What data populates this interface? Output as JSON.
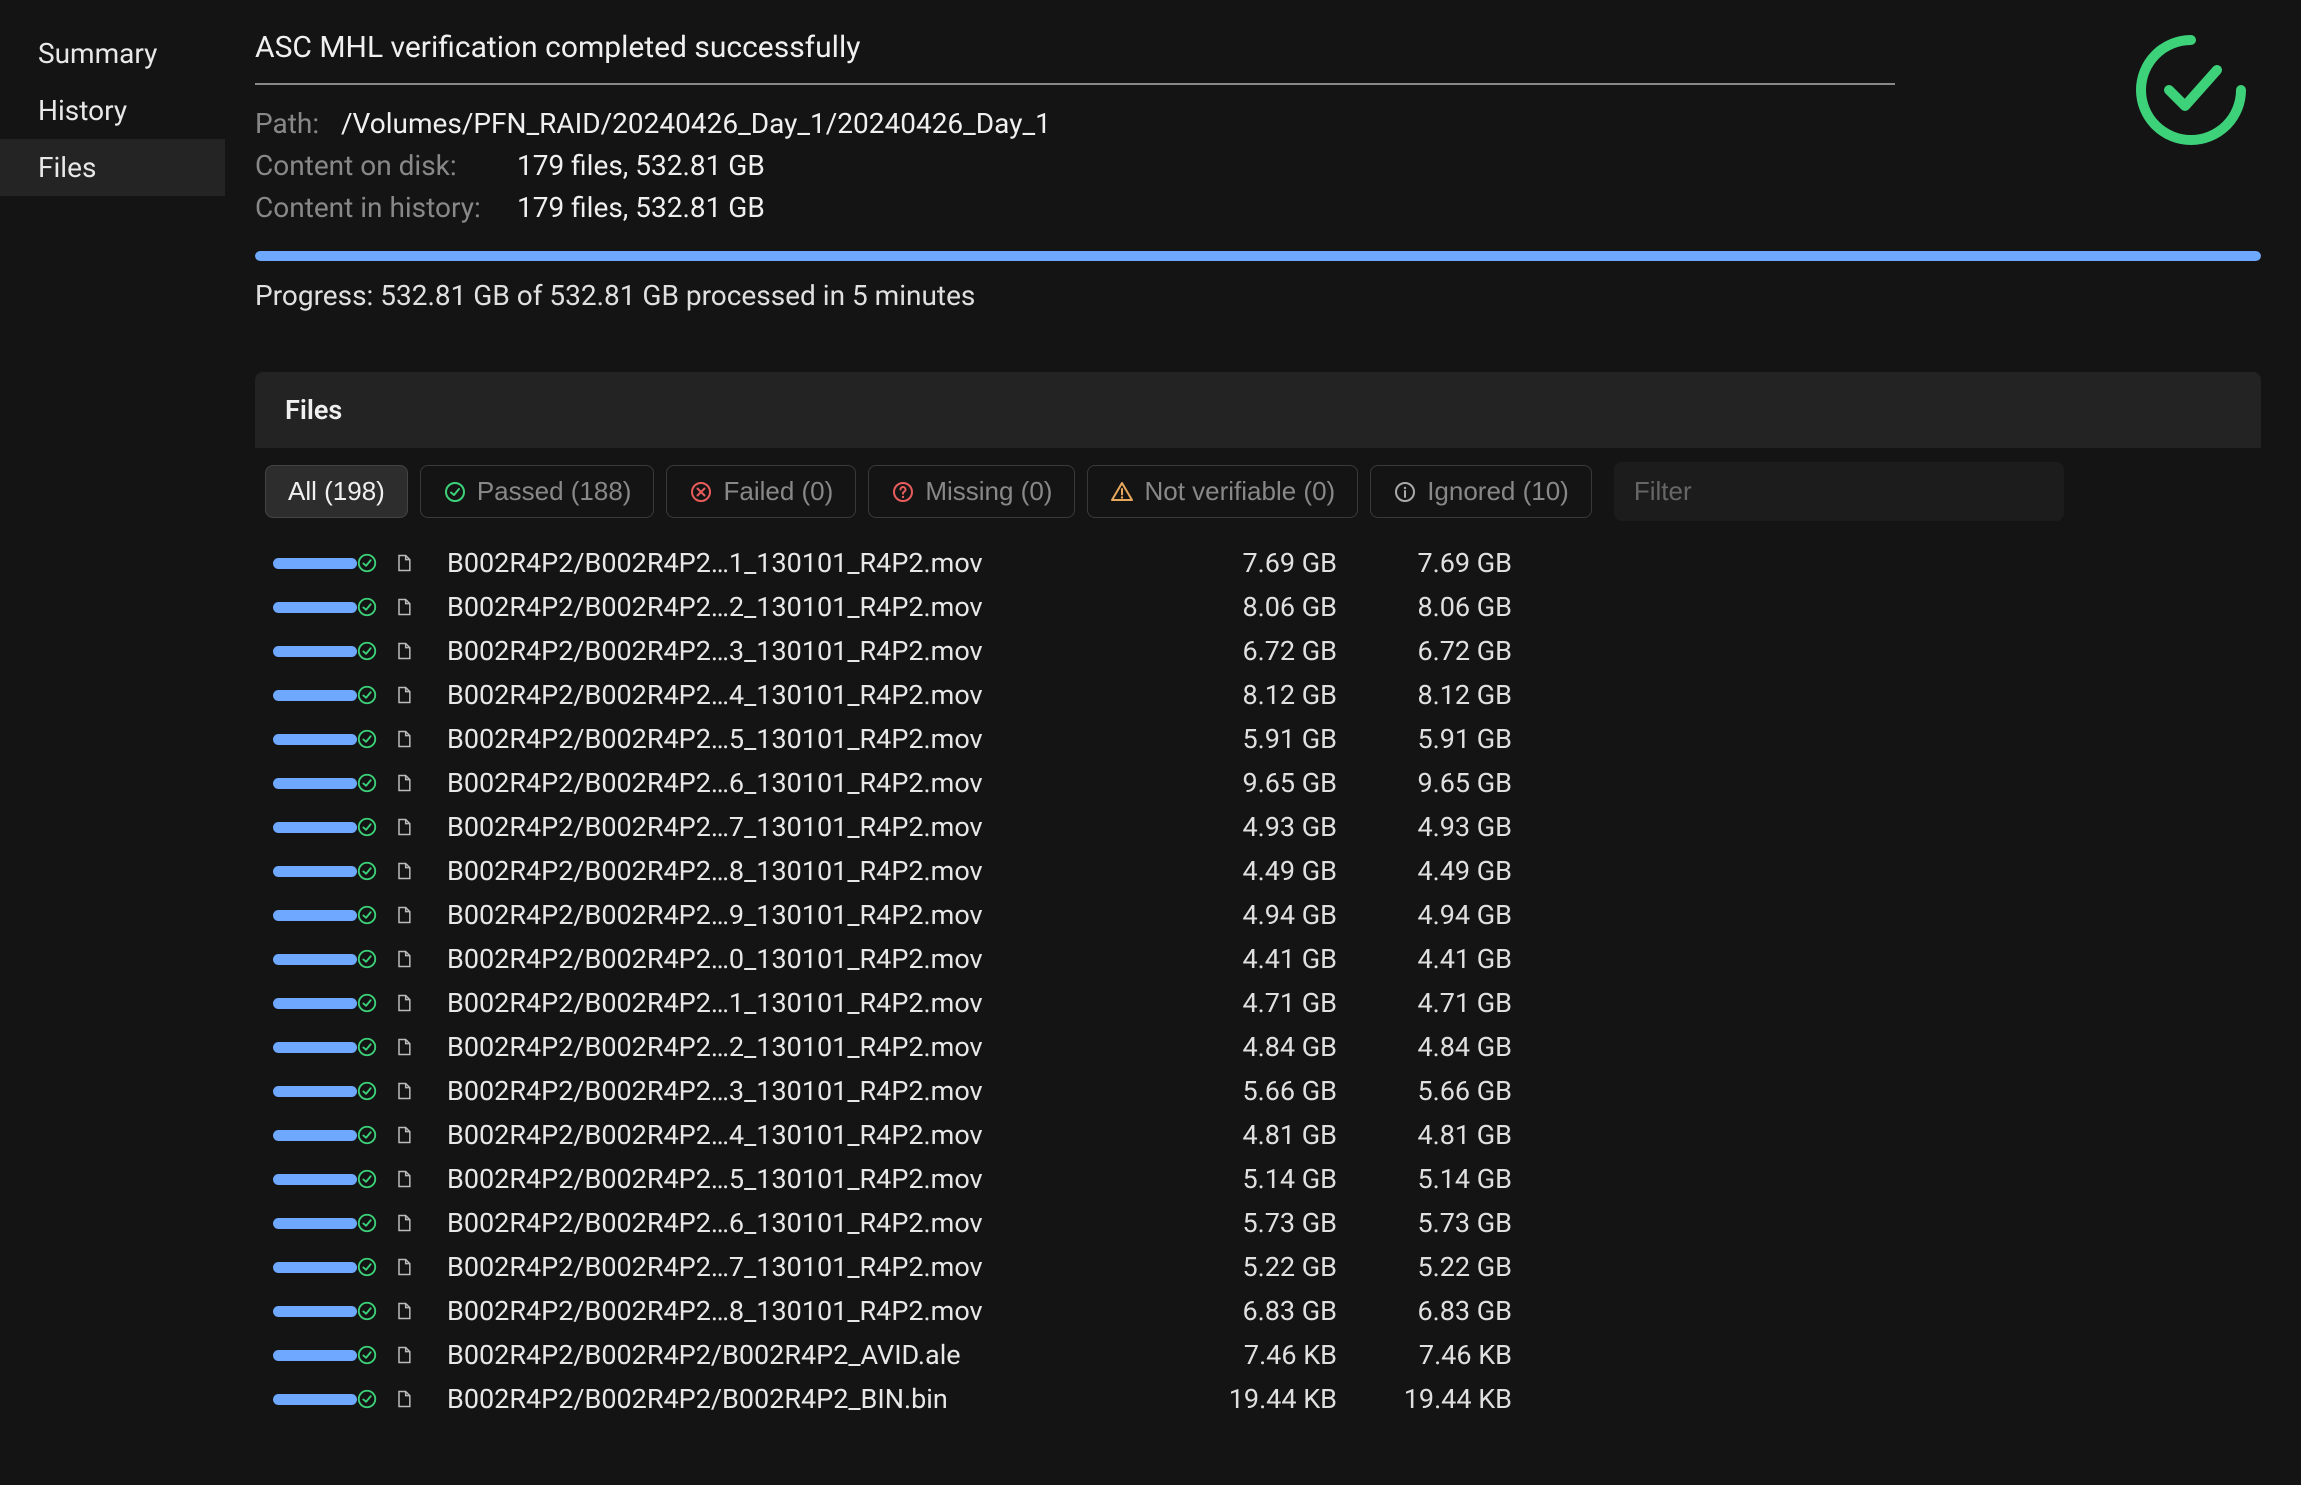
{
  "sidebar": {
    "items": [
      {
        "label": "Summary",
        "active": false
      },
      {
        "label": "History",
        "active": false
      },
      {
        "label": "Files",
        "active": true
      }
    ]
  },
  "header": {
    "title": "ASC MHL verification completed successfully",
    "path_label": "Path:",
    "path_value": "/Volumes/PFN_RAID/20240426_Day_1/20240426_Day_1",
    "disk_label": "Content on disk:",
    "disk_value": "179 files, 532.81 GB",
    "history_label": "Content in history:",
    "history_value": "179 files, 532.81 GB",
    "progress_pct": 100,
    "progress_text": "Progress: 532.81 GB of 532.81 GB processed in 5 minutes"
  },
  "colors": {
    "accent_blue": "#6ea8ff",
    "accent_green": "#3dd17a",
    "accent_red": "#e85c5c",
    "accent_orange": "#e8a85c"
  },
  "section": {
    "title": "Files",
    "filters": {
      "all": "All (198)",
      "passed": "Passed (188)",
      "failed": "Failed (0)",
      "missing": "Missing (0)",
      "not_verifiable": "Not verifiable (0)",
      "ignored": "Ignored (10)",
      "filter_placeholder": "Filter"
    }
  },
  "files": [
    {
      "name": "B002R4P2/B002R4P2…1_130101_R4P2.mov",
      "s1": "7.69 GB",
      "s2": "7.69 GB"
    },
    {
      "name": "B002R4P2/B002R4P2…2_130101_R4P2.mov",
      "s1": "8.06 GB",
      "s2": "8.06 GB"
    },
    {
      "name": "B002R4P2/B002R4P2…3_130101_R4P2.mov",
      "s1": "6.72 GB",
      "s2": "6.72 GB"
    },
    {
      "name": "B002R4P2/B002R4P2…4_130101_R4P2.mov",
      "s1": "8.12 GB",
      "s2": "8.12 GB"
    },
    {
      "name": "B002R4P2/B002R4P2…5_130101_R4P2.mov",
      "s1": "5.91 GB",
      "s2": "5.91 GB"
    },
    {
      "name": "B002R4P2/B002R4P2…6_130101_R4P2.mov",
      "s1": "9.65 GB",
      "s2": "9.65 GB"
    },
    {
      "name": "B002R4P2/B002R4P2…7_130101_R4P2.mov",
      "s1": "4.93 GB",
      "s2": "4.93 GB"
    },
    {
      "name": "B002R4P2/B002R4P2…8_130101_R4P2.mov",
      "s1": "4.49 GB",
      "s2": "4.49 GB"
    },
    {
      "name": "B002R4P2/B002R4P2…9_130101_R4P2.mov",
      "s1": "4.94 GB",
      "s2": "4.94 GB"
    },
    {
      "name": "B002R4P2/B002R4P2…0_130101_R4P2.mov",
      "s1": "4.41 GB",
      "s2": "4.41 GB"
    },
    {
      "name": "B002R4P2/B002R4P2…1_130101_R4P2.mov",
      "s1": "4.71 GB",
      "s2": "4.71 GB"
    },
    {
      "name": "B002R4P2/B002R4P2…2_130101_R4P2.mov",
      "s1": "4.84 GB",
      "s2": "4.84 GB"
    },
    {
      "name": "B002R4P2/B002R4P2…3_130101_R4P2.mov",
      "s1": "5.66 GB",
      "s2": "5.66 GB"
    },
    {
      "name": "B002R4P2/B002R4P2…4_130101_R4P2.mov",
      "s1": "4.81 GB",
      "s2": "4.81 GB"
    },
    {
      "name": "B002R4P2/B002R4P2…5_130101_R4P2.mov",
      "s1": "5.14 GB",
      "s2": "5.14 GB"
    },
    {
      "name": "B002R4P2/B002R4P2…6_130101_R4P2.mov",
      "s1": "5.73 GB",
      "s2": "5.73 GB"
    },
    {
      "name": "B002R4P2/B002R4P2…7_130101_R4P2.mov",
      "s1": "5.22 GB",
      "s2": "5.22 GB"
    },
    {
      "name": "B002R4P2/B002R4P2…8_130101_R4P2.mov",
      "s1": "6.83 GB",
      "s2": "6.83 GB"
    },
    {
      "name": "B002R4P2/B002R4P2/B002R4P2_AVID.ale",
      "s1": "7.46 KB",
      "s2": "7.46 KB"
    },
    {
      "name": "B002R4P2/B002R4P2/B002R4P2_BIN.bin",
      "s1": "19.44 KB",
      "s2": "19.44 KB"
    }
  ]
}
